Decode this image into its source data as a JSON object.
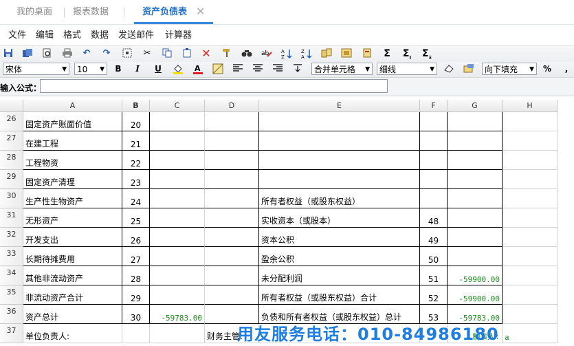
{
  "tabs": [
    {
      "label": "我的桌面"
    },
    {
      "label": "报表数据"
    },
    {
      "label": "资产负债表"
    }
  ],
  "tab_close": "✕",
  "menu": [
    "文件",
    "编辑",
    "格式",
    "数据",
    "发送邮件",
    "计算器"
  ],
  "toolbar2": {
    "font": "宋体",
    "size": "10",
    "bold": "B",
    "italic": "I",
    "underline": "U",
    "merge": "合并单元格",
    "line": "细线",
    "fill": "向下填充",
    "percent": "%"
  },
  "formula": {
    "label": "输入公式：",
    "value": ""
  },
  "columns": [
    "A",
    "B",
    "C",
    "D",
    "E",
    "F",
    "G",
    "H"
  ],
  "rows": [
    {
      "num": "26",
      "a": "固定资产账面价值",
      "b": "20",
      "c": "",
      "e": "",
      "f": "",
      "g": ""
    },
    {
      "num": "27",
      "a": "在建工程",
      "b": "21",
      "c": "",
      "e": "",
      "f": "",
      "g": ""
    },
    {
      "num": "28",
      "a": "工程物资",
      "b": "22",
      "c": "",
      "e": "",
      "f": "",
      "g": ""
    },
    {
      "num": "29",
      "a": "固定资产清理",
      "b": "23",
      "c": "",
      "e": "",
      "f": "",
      "g": ""
    },
    {
      "num": "30",
      "a": "生产性生物资产",
      "b": "24",
      "c": "",
      "e": "所有者权益（或股东权益）",
      "f": "",
      "g": ""
    },
    {
      "num": "31",
      "a": "无形资产",
      "b": "25",
      "c": "",
      "e": "实收资本（或股本）",
      "f": "48",
      "g": ""
    },
    {
      "num": "32",
      "a": "开发支出",
      "b": "26",
      "c": "",
      "e": "资本公积",
      "f": "49",
      "g": ""
    },
    {
      "num": "33",
      "a": "长期待摊费用",
      "b": "27",
      "c": "",
      "e": "盈余公积",
      "f": "50",
      "g": ""
    },
    {
      "num": "34",
      "a": "其他非流动资产",
      "b": "28",
      "c": "",
      "e": "未分配利润",
      "f": "51",
      "g": "-59900.00"
    },
    {
      "num": "35",
      "a": "非流动资产合计",
      "b": "29",
      "c": "",
      "e": "所有者权益（或股东权益）合计",
      "f": "52",
      "g": "-59900.00"
    },
    {
      "num": "36",
      "a": "资产总计",
      "b": "30",
      "c": "-59783.00",
      "e": "负债和所有者权益（或股东权益）总计",
      "f": "53",
      "g": "-59783.00"
    },
    {
      "num": "37",
      "a": "单位负责人:",
      "b": "",
      "c": "",
      "d": "财务主管:",
      "e": "",
      "f": "",
      "g": "制表人:",
      "h": "a"
    }
  ],
  "watermark": "用友服务电话：010-84986180",
  "colors": {
    "accent": "#1d6fc8",
    "value_green": "#1a8a1a",
    "watermark": "#1f7fe0"
  }
}
